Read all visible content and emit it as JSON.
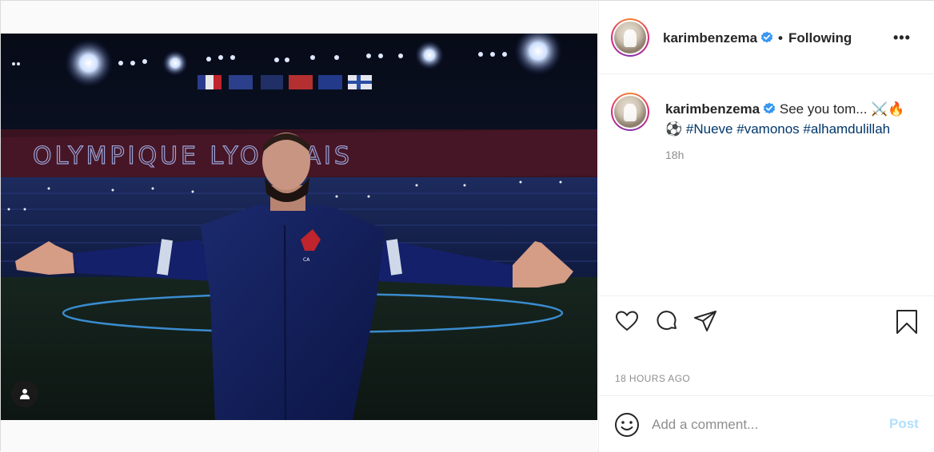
{
  "post": {
    "username": "karimbenzema",
    "follow_status": "Following",
    "separator": "•",
    "more_label": "•••",
    "caption_text": "See you tom... ⚔️🔥",
    "caption_line2_emoji": "⚽",
    "hashtags": [
      "#Nueve",
      "#vamonos",
      "#alhamdulillah"
    ],
    "caption_age": "18h",
    "timestamp": "18 HOURS AGO"
  },
  "comment": {
    "placeholder": "Add a comment...",
    "post_label": "Post"
  },
  "photo": {
    "stadium_sign": "OLYMPIQUE LYONNAIS"
  },
  "colors": {
    "link": "#00376b",
    "verified": "#3897f0",
    "post_disabled": "#b2dffc",
    "muted": "#8e8e8e"
  },
  "icons": {
    "like": "heart-icon",
    "comment": "comment-bubble-icon",
    "share": "paper-plane-icon",
    "save": "bookmark-icon",
    "emoji": "smiley-icon",
    "tag": "user-tag-icon",
    "more": "more-options-icon"
  }
}
